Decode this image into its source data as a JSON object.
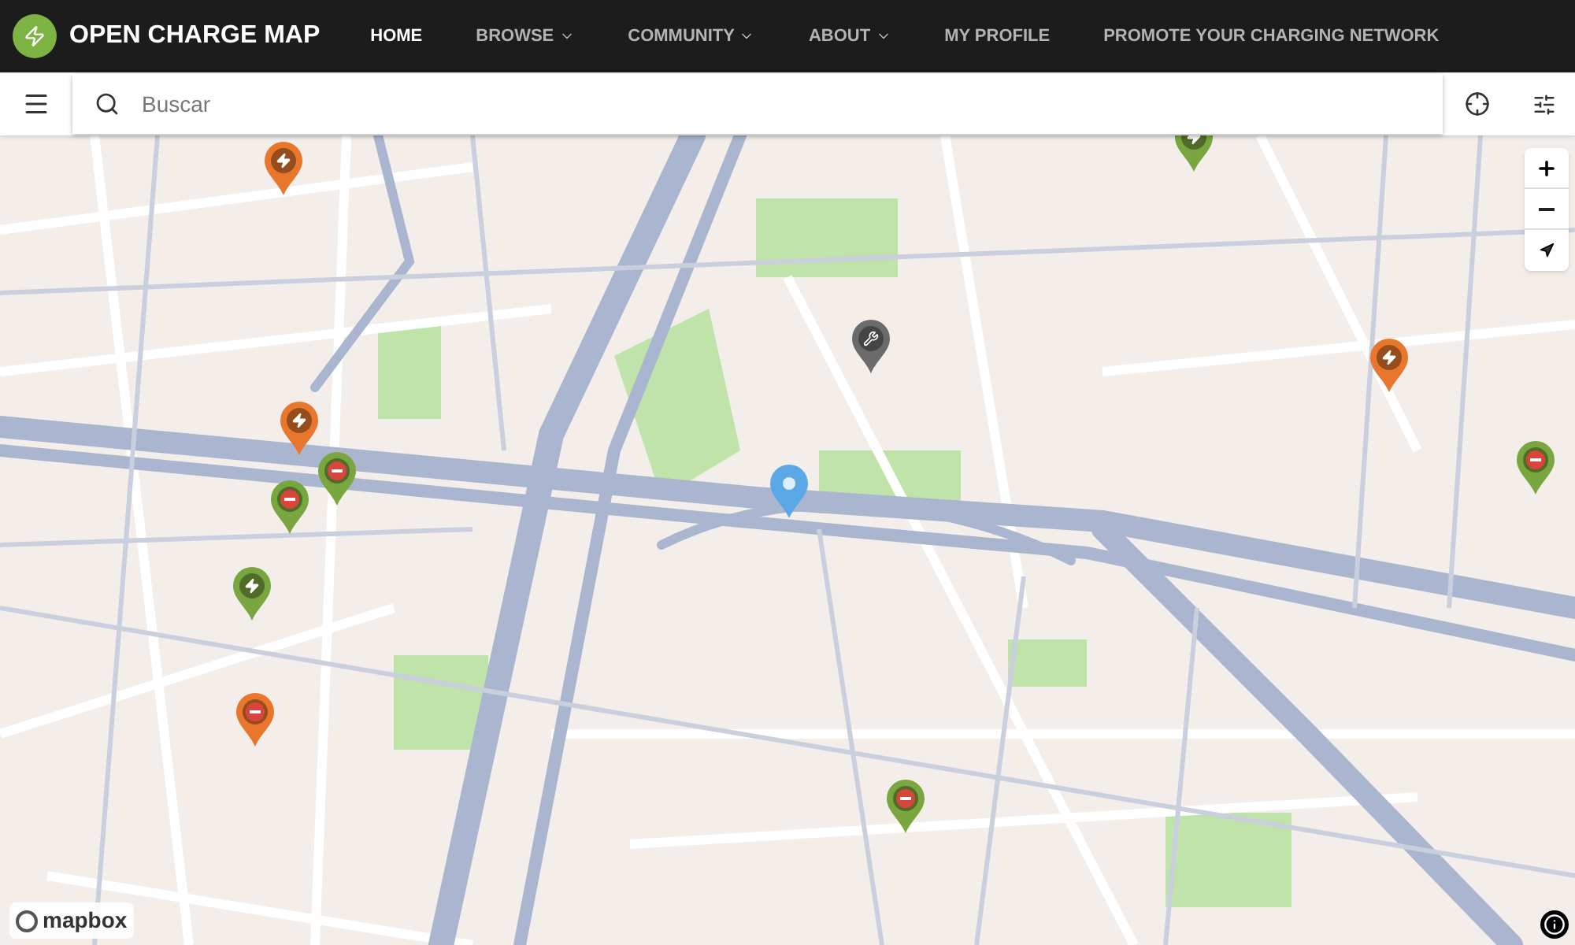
{
  "brand": {
    "name": "OPEN CHARGE MAP"
  },
  "nav": [
    {
      "label": "HOME",
      "selected": true,
      "dropdown": false
    },
    {
      "label": "BROWSE",
      "selected": false,
      "dropdown": true
    },
    {
      "label": "COMMUNITY",
      "selected": false,
      "dropdown": true
    },
    {
      "label": "ABOUT",
      "selected": false,
      "dropdown": true
    },
    {
      "label": "MY PROFILE",
      "selected": false,
      "dropdown": false
    },
    {
      "label": "PROMOTE YOUR CHARGING NETWORK",
      "selected": false,
      "dropdown": false
    }
  ],
  "search": {
    "placeholder": "Buscar"
  },
  "markers": [
    {
      "kind": "lightning",
      "color": "#e8762c"
    },
    {
      "kind": "lightning",
      "color": "#7aa63f"
    },
    {
      "kind": "wrench",
      "color": "#6b6b6b"
    },
    {
      "kind": "lightning",
      "color": "#e8762c"
    },
    {
      "kind": "lightning",
      "color": "#e8762c"
    },
    {
      "kind": "no-entry",
      "color": "#7aa63f"
    },
    {
      "kind": "no-entry",
      "color": "#7aa63f"
    },
    {
      "kind": "plain",
      "color": "#5aa9e6"
    },
    {
      "kind": "lightning",
      "color": "#7aa63f"
    },
    {
      "kind": "no-entry",
      "color": "#e8762c"
    },
    {
      "kind": "no-entry",
      "color": "#7aa63f"
    },
    {
      "kind": "no-entry",
      "color": "#7aa63f"
    }
  ],
  "attribution": "mapbox"
}
